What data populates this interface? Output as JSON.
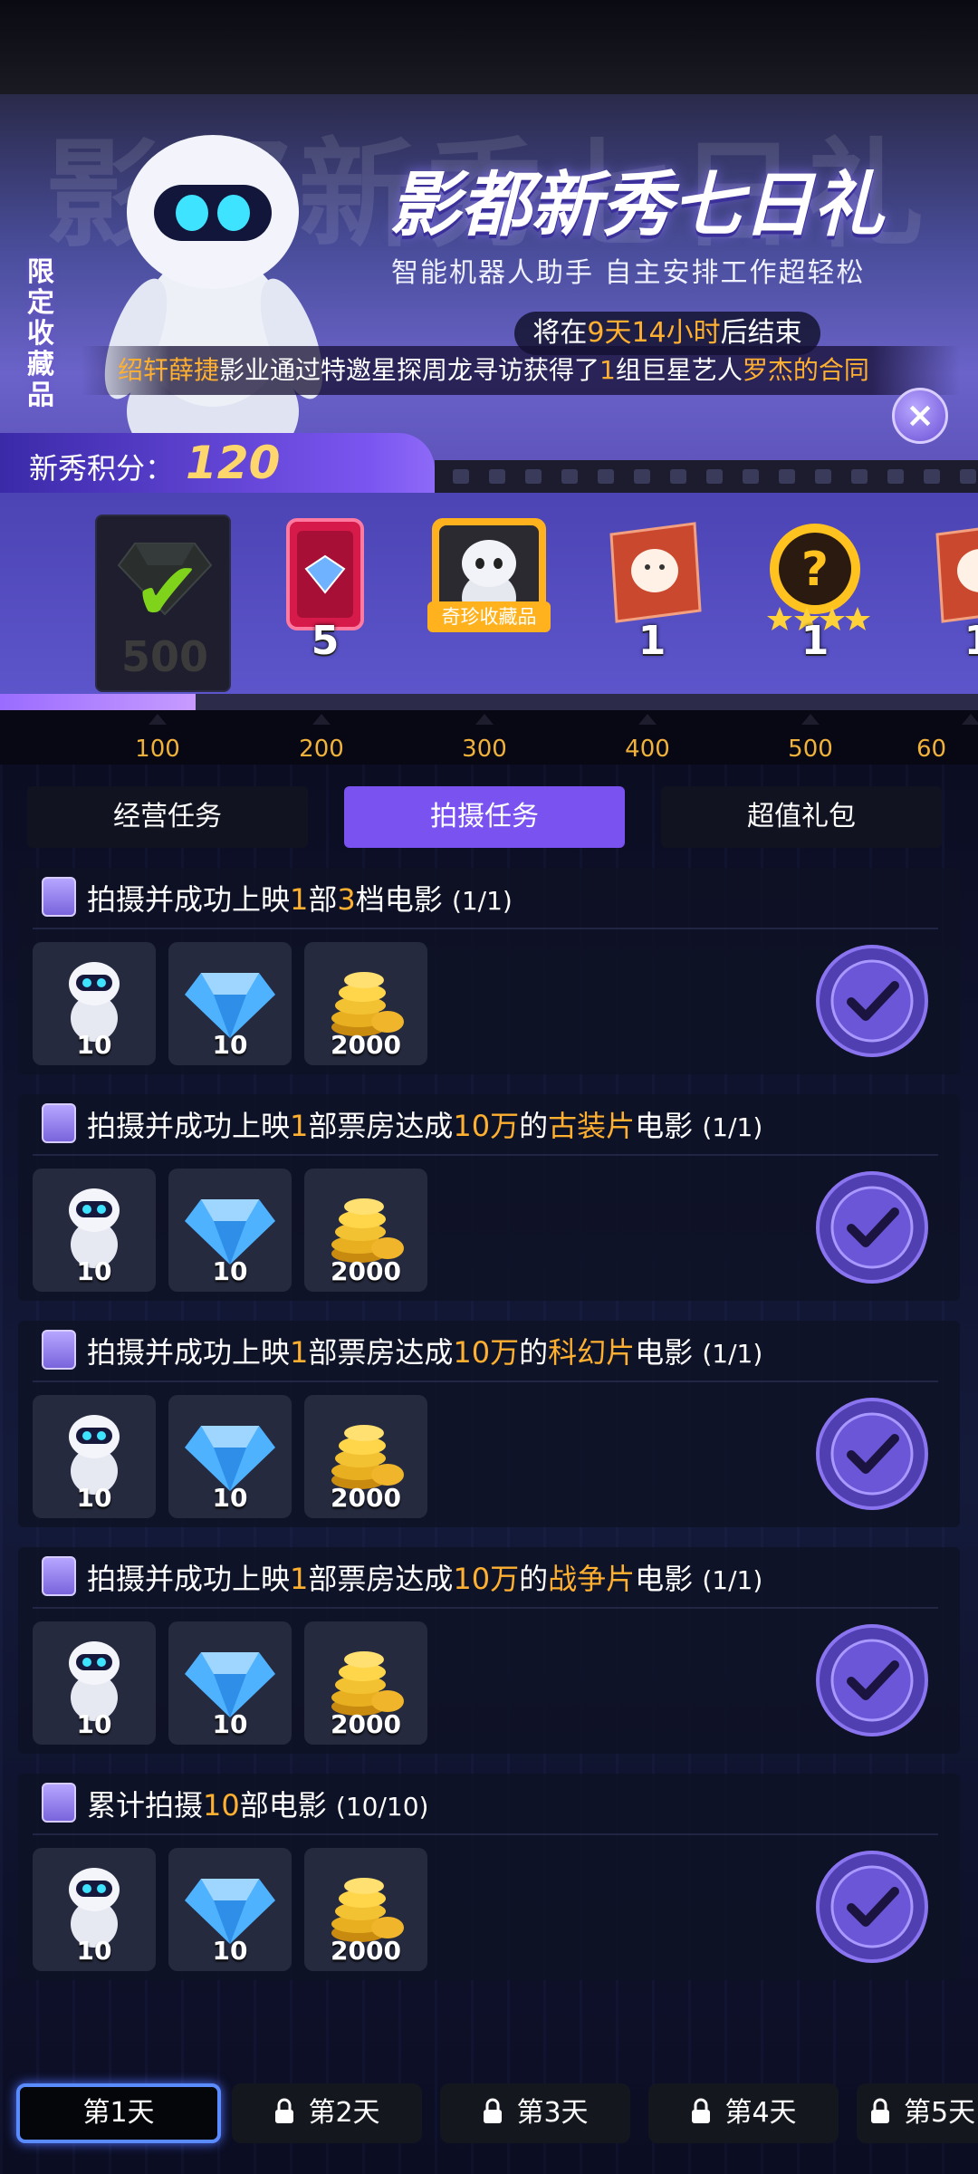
{
  "banner": {
    "ghost_text": "影都新秀七日礼",
    "limited_label": "限定收藏品",
    "title": "影都新秀七日礼",
    "subtitle": "智能机器人助手  自主安排工作超轻松",
    "countdown": {
      "prefix": "将在",
      "time": "9天14小时",
      "suffix": "后结束"
    },
    "marquee": {
      "player": "绍轩薛捷",
      "text1": "影业通过特邀星探周龙寻访获得了",
      "num": "1",
      "text2": "组巨星艺人",
      "target": "罗杰的合同"
    }
  },
  "points": {
    "label": "新秀积分：",
    "value": "120"
  },
  "rewards": [
    {
      "icon": "gem-icon",
      "count": "500",
      "claimed": true
    },
    {
      "icon": "card-icon",
      "count": "5"
    },
    {
      "icon": "robot-icon",
      "label": "奇珍收藏品"
    },
    {
      "icon": "lucky-cat-book-icon",
      "count": "1"
    },
    {
      "icon": "mystery-star-icon",
      "count": "1"
    },
    {
      "icon": "lucky-cat-book-icon",
      "count": "1"
    }
  ],
  "milestones": [
    "100",
    "200",
    "300",
    "400",
    "500",
    "60"
  ],
  "progress": {
    "fraction": 0.2
  },
  "tabs": [
    {
      "label": "经营任务",
      "active": false
    },
    {
      "label": "拍摄任务",
      "active": true
    },
    {
      "label": "超值礼包",
      "active": false
    }
  ],
  "tasks": [
    {
      "t1": "拍摄并成功上映",
      "n1": "1",
      "t2": "部",
      "n2": "3",
      "t3": "档电影",
      "progress": "(1/1)",
      "rewards": [
        "10",
        "10",
        "2000"
      ]
    },
    {
      "t1": "拍摄并成功上映",
      "n1": "1",
      "t2": "部票房达成",
      "n2": "10万",
      "t3": "的",
      "genre": "古装片",
      "t4": "电影",
      "progress": "(1/1)",
      "rewards": [
        "10",
        "10",
        "2000"
      ]
    },
    {
      "t1": "拍摄并成功上映",
      "n1": "1",
      "t2": "部票房达成",
      "n2": "10万",
      "t3": "的",
      "genre": "科幻片",
      "t4": "电影",
      "progress": "(1/1)",
      "rewards": [
        "10",
        "10",
        "2000"
      ]
    },
    {
      "t1": "拍摄并成功上映",
      "n1": "1",
      "t2": "部票房达成",
      "n2": "10万",
      "t3": "的",
      "genre": "战争片",
      "t4": "电影",
      "progress": "(1/1)",
      "rewards": [
        "10",
        "10",
        "2000"
      ]
    },
    {
      "t1": "累计拍摄",
      "n1": "10",
      "t2": "部电影",
      "progress": "(10/10)",
      "rewards": [
        "10",
        "10",
        "2000"
      ]
    }
  ],
  "days": [
    {
      "label": "第1天",
      "locked": false,
      "active": true
    },
    {
      "label": "第2天",
      "locked": true
    },
    {
      "label": "第3天",
      "locked": true
    },
    {
      "label": "第4天",
      "locked": true
    },
    {
      "label": "第5天",
      "locked": true
    }
  ],
  "colors": {
    "accent": "#7a52f0",
    "highlight": "#ffb030",
    "milestone": "#f0b23a"
  }
}
